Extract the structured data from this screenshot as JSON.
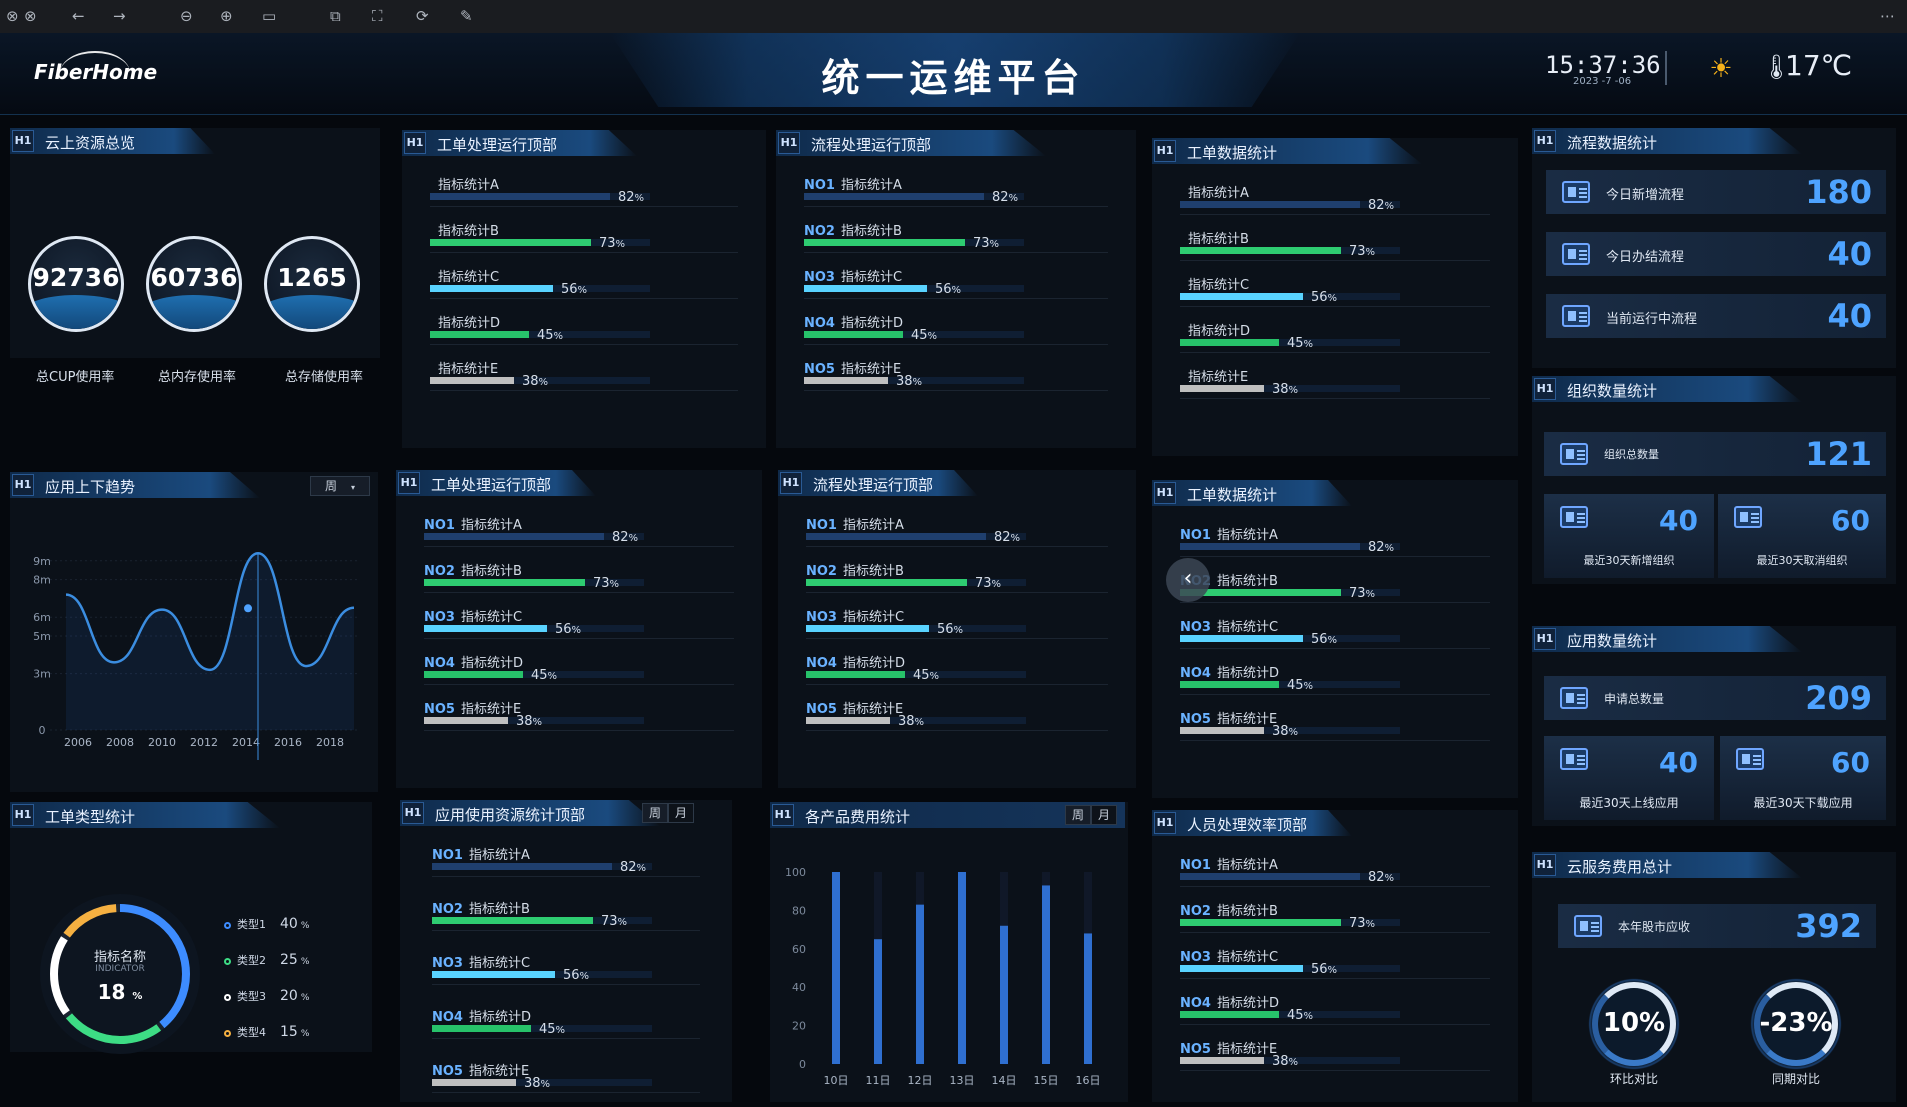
{
  "toolbar_icons": [
    "close-icon",
    "close-icon",
    "back-arrow-icon",
    "forward-arrow-icon",
    "zoom-out-icon",
    "zoom-in-icon",
    "fit-icon",
    "copy-icon",
    "screenshot-icon",
    "rotate-icon",
    "magic-icon",
    "more-icon"
  ],
  "header": {
    "logo": "FiberHome",
    "title": "统一运维平台",
    "time": "15:37:36",
    "date": "2023 -7 -06",
    "temperature": "17℃"
  },
  "h_badge": "H1",
  "cloud": {
    "title": "云上资源总览",
    "items": [
      {
        "value": "92736",
        "label": "总CUP使用率"
      },
      {
        "value": "60736",
        "label": "总内存使用率"
      },
      {
        "value": "1265",
        "label": "总存储使用率"
      }
    ]
  },
  "trend": {
    "title": "应用上下趋势",
    "week": "周",
    "chart_data": {
      "type": "line",
      "x": [
        "2006",
        "2008",
        "2010",
        "2012",
        "2014",
        "2016",
        "2018"
      ],
      "yticks": [
        "0",
        "3m",
        "5m",
        "6m",
        "8m",
        "9m"
      ],
      "series": [
        {
          "values": [
            7.2,
            3.6,
            6.4,
            3.2,
            9.4,
            3.4,
            6.5
          ]
        }
      ]
    }
  },
  "ticket_types": {
    "title": "工单类型统计",
    "center_title": "指标名称",
    "center_sub": "INDICATOR",
    "center_value": "18",
    "center_unit": "%",
    "legend": [
      {
        "label": "类型1",
        "value": "40",
        "unit": "%",
        "color": "#3d8cff"
      },
      {
        "label": "类型2",
        "value": "25",
        "unit": "%",
        "color": "#3ddc84"
      },
      {
        "label": "类型3",
        "value": "20",
        "unit": "%",
        "color": "#ffffff"
      },
      {
        "label": "类型4",
        "value": "15",
        "unit": "%",
        "color": "#f5b041"
      }
    ]
  },
  "bar_lists": [
    {
      "title": "工单处理运行顶部",
      "numbered": false,
      "items": [
        {
          "label": "指标统计A",
          "pct": "82",
          "unit": "%"
        },
        {
          "label": "指标统计B",
          "pct": "73",
          "unit": "%"
        },
        {
          "label": "指标统计C",
          "pct": "56",
          "unit": "%"
        },
        {
          "label": "指标统计D",
          "pct": "45",
          "unit": "%"
        },
        {
          "label": "指标统计E",
          "pct": "38",
          "unit": "%"
        }
      ]
    },
    {
      "title": "流程处理运行顶部",
      "numbered": true,
      "items": [
        {
          "no": "NO1",
          "label": "指标统计A",
          "pct": "82",
          "unit": "%"
        },
        {
          "no": "NO2",
          "label": "指标统计B",
          "pct": "73",
          "unit": "%"
        },
        {
          "no": "NO3",
          "label": "指标统计C",
          "pct": "56",
          "unit": "%"
        },
        {
          "no": "NO4",
          "label": "指标统计D",
          "pct": "45",
          "unit": "%"
        },
        {
          "no": "NO5",
          "label": "指标统计E",
          "pct": "38",
          "unit": "%"
        }
      ]
    },
    {
      "title": "工单数据统计",
      "numbered": false,
      "items": [
        {
          "label": "指标统计A",
          "pct": "82",
          "unit": "%"
        },
        {
          "label": "指标统计B",
          "pct": "73",
          "unit": "%"
        },
        {
          "label": "指标统计C",
          "pct": "56",
          "unit": "%"
        },
        {
          "label": "指标统计D",
          "pct": "45",
          "unit": "%"
        },
        {
          "label": "指标统计E",
          "pct": "38",
          "unit": "%"
        }
      ]
    },
    {
      "title": "工单处理运行顶部",
      "numbered": true,
      "items": [
        {
          "no": "NO1",
          "label": "指标统计A",
          "pct": "82",
          "unit": "%"
        },
        {
          "no": "NO2",
          "label": "指标统计B",
          "pct": "73",
          "unit": "%"
        },
        {
          "no": "NO3",
          "label": "指标统计C",
          "pct": "56",
          "unit": "%"
        },
        {
          "no": "NO4",
          "label": "指标统计D",
          "pct": "45",
          "unit": "%"
        },
        {
          "no": "NO5",
          "label": "指标统计E",
          "pct": "38",
          "unit": "%"
        }
      ]
    },
    {
      "title": "流程处理运行顶部",
      "numbered": true,
      "items": [
        {
          "no": "NO1",
          "label": "指标统计A",
          "pct": "82",
          "unit": "%"
        },
        {
          "no": "NO2",
          "label": "指标统计B",
          "pct": "73",
          "unit": "%"
        },
        {
          "no": "NO3",
          "label": "指标统计C",
          "pct": "56",
          "unit": "%"
        },
        {
          "no": "NO4",
          "label": "指标统计D",
          "pct": "45",
          "unit": "%"
        },
        {
          "no": "NO5",
          "label": "指标统计E",
          "pct": "38",
          "unit": "%"
        }
      ]
    },
    {
      "title": "工单数据统计",
      "numbered": true,
      "items": [
        {
          "no": "NO1",
          "label": "指标统计A",
          "pct": "82",
          "unit": "%"
        },
        {
          "no": "NO2",
          "label": "指标统计B",
          "pct": "73",
          "unit": "%"
        },
        {
          "no": "NO3",
          "label": "指标统计C",
          "pct": "56",
          "unit": "%"
        },
        {
          "no": "NO4",
          "label": "指标统计D",
          "pct": "45",
          "unit": "%"
        },
        {
          "no": "NO5",
          "label": "指标统计E",
          "pct": "38",
          "unit": "%"
        }
      ]
    },
    {
      "title": "应用使用资源统计顶部",
      "numbered": true,
      "tabs": [
        "周",
        "月"
      ],
      "items": [
        {
          "no": "NO1",
          "label": "指标统计A",
          "pct": "82",
          "unit": "%"
        },
        {
          "no": "NO2",
          "label": "指标统计B",
          "pct": "73",
          "unit": "%"
        },
        {
          "no": "NO3",
          "label": "指标统计C",
          "pct": "56",
          "unit": "%"
        },
        {
          "no": "NO4",
          "label": "指标统计D",
          "pct": "45",
          "unit": "%"
        },
        {
          "no": "NO5",
          "label": "指标统计E",
          "pct": "38",
          "unit": "%"
        }
      ]
    },
    {
      "title": "人员处理效率顶部",
      "numbered": true,
      "items": [
        {
          "no": "NO1",
          "label": "指标统计A",
          "pct": "82",
          "unit": "%"
        },
        {
          "no": "NO2",
          "label": "指标统计B",
          "pct": "73",
          "unit": "%"
        },
        {
          "no": "NO3",
          "label": "指标统计C",
          "pct": "56",
          "unit": "%"
        },
        {
          "no": "NO4",
          "label": "指标统计D",
          "pct": "45",
          "unit": "%"
        },
        {
          "no": "NO5",
          "label": "指标统计E",
          "pct": "38",
          "unit": "%"
        }
      ]
    }
  ],
  "bar_colors": [
    "#1f3f6e",
    "#2ecc71",
    "#59d3ff",
    "#27c26a",
    "#bfbfbf"
  ],
  "costs": {
    "title": "各产品费用统计",
    "tabs": [
      "周",
      "月"
    ],
    "chart_data": {
      "type": "bar",
      "categories": [
        "10日",
        "11日",
        "12日",
        "13日",
        "14日",
        "15日",
        "16日"
      ],
      "values": [
        100,
        65,
        83,
        100,
        72,
        93,
        68
      ],
      "ylim": [
        0,
        100
      ],
      "yticks": [
        "0",
        "20",
        "40",
        "60",
        "80",
        "100"
      ]
    }
  },
  "flow_stats": {
    "title": "流程数据统计",
    "cards": [
      {
        "label": "今日新增流程",
        "value": "180"
      },
      {
        "label": "今日办结流程",
        "value": "40"
      },
      {
        "label": "当前运行中流程",
        "value": "40"
      }
    ]
  },
  "org_stats": {
    "title": "组织数量统计",
    "total_label": "组织总数量",
    "total": "121",
    "subs": [
      {
        "value": "40",
        "label": "最近30天新增组织"
      },
      {
        "value": "60",
        "label": "最近30天取消组织"
      }
    ]
  },
  "app_stats": {
    "title": "应用数量统计",
    "total_label": "申请总数量",
    "total": "209",
    "subs": [
      {
        "value": "40",
        "label": "最近30天上线应用"
      },
      {
        "value": "60",
        "label": "最近30天下载应用"
      }
    ]
  },
  "cloud_cost": {
    "title": "云服务费用总计",
    "total_label": "本年股市应收",
    "total": "392",
    "gauges": [
      {
        "value": "10%",
        "label": "环比对比"
      },
      {
        "value": "-23%",
        "label": "同期对比"
      }
    ]
  }
}
